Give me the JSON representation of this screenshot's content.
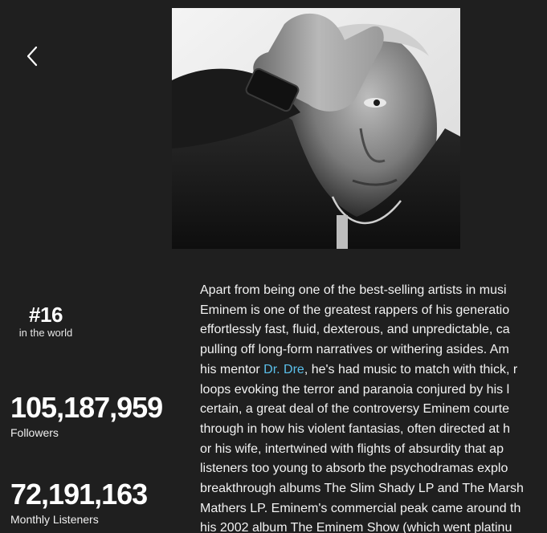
{
  "header": {
    "back_icon": "chevron-left-icon"
  },
  "artist": {
    "photo_alt": "Eminem"
  },
  "rank": {
    "number": "#16",
    "caption": "in the world"
  },
  "stats": {
    "followers_value": "105,187,959",
    "followers_label": "Followers",
    "monthly_value": "72,191,163",
    "monthly_label": "Monthly Listeners"
  },
  "bio": {
    "lines": [
      "Apart from being one of the best-selling artists in musi",
      "Eminem is one of the greatest rappers of his generatio",
      "effortlessly fast, fluid, dexterous, and unpredictable, ca",
      "pulling off long-form narratives or withering asides. Am",
      "his mentor ",
      "loops evoking the terror and paranoia conjured by his l",
      "certain, a great deal of the controversy Eminem courte",
      "through in how his violent fantasias, often directed at h",
      "or his wife, intertwined with flights of absurdity that ap",
      "listeners too young to absorb the psychodramas explo",
      "breakthrough albums The Slim Shady LP and The Marsh",
      "Mathers LP. Eminem's commercial peak came around th",
      "his 2002 album The Eminem Show (which went platinu"
    ],
    "link_text": "Dr. Dre",
    "line5_after_link": ", he's had music to match with thick, r"
  }
}
